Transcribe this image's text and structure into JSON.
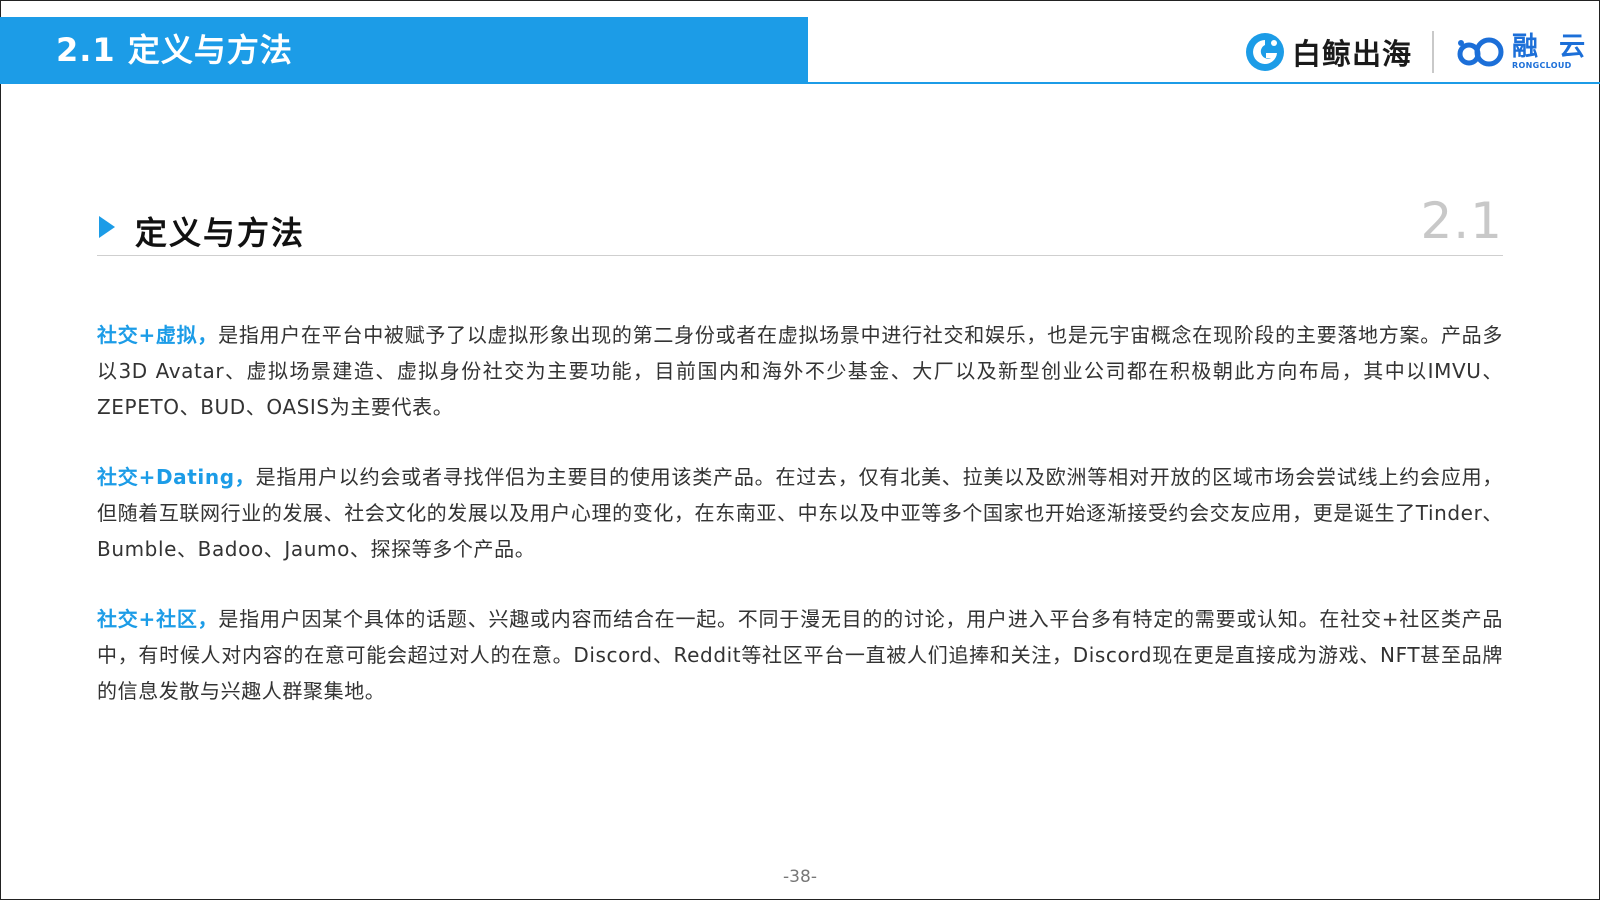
{
  "header": {
    "title": "2.1 定义与方法",
    "brand_color": "#1c9ce7"
  },
  "logos": {
    "baijing": {
      "icon": "baijing-logo-icon",
      "text": "白鲸出海"
    },
    "rongcloud": {
      "icon": "rongcloud-logo-icon",
      "text_cn": "融 云",
      "text_en": "RONGCLOUD"
    }
  },
  "section": {
    "title": "定义与方法",
    "number": "2.1"
  },
  "paragraphs": [
    {
      "lead": "社交+虚拟，",
      "body": "是指用户在平台中被赋予了以虚拟形象出现的第二身份或者在虚拟场景中进行社交和娱乐，也是元宇宙概念在现阶段的主要落地方案。产品多以3D Avatar、虚拟场景建造、虚拟身份社交为主要功能，目前国内和海外不少基金、大厂以及新型创业公司都在积极朝此方向布局，其中以IMVU、ZEPETO、BUD、OASIS为主要代表。"
    },
    {
      "lead": "社交+Dating，",
      "body": "是指用户以约会或者寻找伴侣为主要目的使用该类产品。在过去，仅有北美、拉美以及欧洲等相对开放的区域市场会尝试线上约会应用，但随着互联网行业的发展、社会文化的发展以及用户心理的变化，在东南亚、中东以及中亚等多个国家也开始逐渐接受约会交友应用，更是诞生了Tinder、Bumble、Badoo、Jaumo、探探等多个产品。"
    },
    {
      "lead": "社交+社区，",
      "body": "是指用户因某个具体的话题、兴趣或内容而结合在一起。不同于漫无目的的讨论，用户进入平台多有特定的需要或认知。在社交+社区类产品中，有时候人对内容的在意可能会超过对人的在意。Discord、Reddit等社区平台一直被人们追捧和关注，Discord现在更是直接成为游戏、NFT甚至品牌的信息发散与兴趣人群聚集地。"
    }
  ],
  "footer": {
    "page_number": "-38-"
  }
}
